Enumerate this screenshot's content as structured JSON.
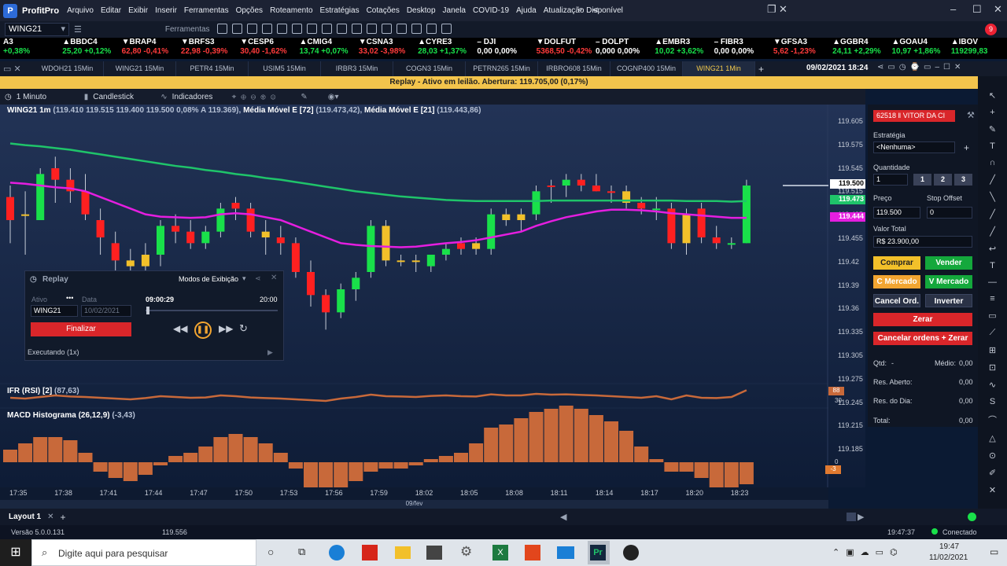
{
  "app": {
    "name": "ProfitPro",
    "menu": [
      "Arquivo",
      "Editar",
      "Exibir",
      "Inserir",
      "Ferramentas",
      "Opções",
      "Roteamento",
      "Estratégias",
      "Cotações",
      "Desktop",
      "Janela",
      "COVID-19",
      "Ajuda",
      "Atualização Disponível"
    ],
    "notify_count": "9"
  },
  "toolbar": {
    "asset": "WING21",
    "tools_label": "Ferramentas"
  },
  "ticker": [
    {
      "name": "A3",
      "value": "+0,38%",
      "dir": "up"
    },
    {
      "name": "▲BBDC4",
      "value": "25,20 +0,12%",
      "dir": "up"
    },
    {
      "name": "▼BRAP4",
      "value": "62,80 -0,41%",
      "dir": "dn"
    },
    {
      "name": "▼BRFS3",
      "value": "22,98 -0,39%",
      "dir": "dn"
    },
    {
      "name": "▼CESP6",
      "value": "30,40 -1,62%",
      "dir": "dn"
    },
    {
      "name": "▲CMIG4",
      "value": "13,74 +0,07%",
      "dir": "up"
    },
    {
      "name": "▼CSNA3",
      "value": "33,02 -3,98%",
      "dir": "dn"
    },
    {
      "name": "▲CYRE3",
      "value": "28,03 +1,37%",
      "dir": "up"
    },
    {
      "name": "– DJI",
      "value": "0,00 0,00%",
      "dir": "fl"
    },
    {
      "name": "▼DOLFUT",
      "value": "5368,50 -0,42%",
      "dir": "dn"
    },
    {
      "name": "– DOLPT",
      "value": "0,000 0,00%",
      "dir": "fl"
    },
    {
      "name": "▲EMBR3",
      "value": "10,02 +3,62%",
      "dir": "up"
    },
    {
      "name": "– FIBR3",
      "value": "0,00 0,00%",
      "dir": "fl"
    },
    {
      "name": "▼GFSA3",
      "value": "5,62 -1,23%",
      "dir": "dn"
    },
    {
      "name": "▲GGBR4",
      "value": "24,11 +2,29%",
      "dir": "up"
    },
    {
      "name": "▲GOAU4",
      "value": "10,97 +1,86%",
      "dir": "up"
    },
    {
      "name": "▲IBOV",
      "value": "119299,83",
      "dir": "up"
    }
  ],
  "tabs": [
    "WDOH21 15Min",
    "WING21 15Min",
    "PETR4 15Min",
    "USIM5 15Min",
    "IRBR3 15Min",
    "COGN3 15Min",
    "PETRN265 15Min",
    "IRBRO608 15Min",
    "COGNP400 15Min",
    "WING21 1Min"
  ],
  "datetime": "09/02/2021 18:24",
  "replay_banner": "Replay - Ativo em leilão. Abertura: 119.705,00 (0,17%)",
  "chart_tools": {
    "interval": "1 Minuto",
    "type": "Candlestick",
    "indicators": "Indicadores"
  },
  "chart_header": {
    "symbol": "WING21 1m",
    "ohlc": "(119.410  119.515  119.400  119.500  0,08%  A 119.369),",
    "ma1_label": "Média Móvel E [72]",
    "ma1_value": "(119.473,42),",
    "ma2_label": "Média Móvel E [21]",
    "ma2_value": "(119.443,86)"
  },
  "price_axis": [
    "119.605",
    "119.575",
    "119.545",
    "119.515",
    "119.485",
    "119.455",
    "119.42",
    "119.39",
    "119.36",
    "119.335",
    "119.305",
    "119.275",
    "119.245",
    "119.215",
    "119.185"
  ],
  "price_tags": {
    "last": "119.500",
    "ma1": "119.473",
    "ma2": "119.444"
  },
  "rsi": {
    "label": "IFR (RSI) [2]",
    "value": "(87,63)",
    "tag": "88",
    "level": "30"
  },
  "macd": {
    "label": "MACD Histograma (26,12,9)",
    "value": "(-3,43)",
    "zero": "0",
    "tag": "-3"
  },
  "time_axis": [
    "17:35",
    "17:38",
    "17:41",
    "17:44",
    "17:47",
    "17:50",
    "17:53",
    "17:56",
    "17:59",
    "18:02",
    "18:05",
    "18:08",
    "18:11",
    "18:14",
    "18:17",
    "18:20",
    "18:23"
  ],
  "date_label": "09/fev",
  "right_panel": {
    "account": "62518 ‖ VITOR DA CI",
    "strategy_label": "Estratégia",
    "strategy_value": "<Nenhuma>",
    "qty_label": "Quantidade",
    "qty_value": "1",
    "qty_presets": [
      "1",
      "2",
      "3"
    ],
    "price_label": "Preço",
    "price_value": "119.500",
    "stop_label": "Stop Offset",
    "stop_value": "0",
    "total_label": "Valor Total",
    "total_value": "R$ 23.900,00",
    "buttons": {
      "buy": "Comprar",
      "sell": "Vender",
      "buy_mkt": "C Mercado",
      "sell_mkt": "V Mercado",
      "cancel": "Cancel Ord.",
      "invert": "Inverter",
      "zero": "Zerar",
      "cancel_zero": "Cancelar ordens + Zerar"
    },
    "info": [
      {
        "k": "Qtd:",
        "v": "-",
        "k2": "Médio:",
        "v2": "0,00"
      },
      {
        "k": "Res. Aberto:",
        "v": "0,00"
      },
      {
        "k": "Res. do Dia:",
        "v": "0,00"
      },
      {
        "k": "Total:",
        "v": "0,00"
      }
    ]
  },
  "replay": {
    "title": "Replay",
    "modes": "Modos de Exibição",
    "asset_label": "Ativo",
    "asset_value": "WING21",
    "date_label": "Data",
    "date_value": "10/02/2021",
    "time_current": "09:00:29",
    "time_end": "20:00",
    "finish": "Finalizar",
    "status": "Executando (1x)"
  },
  "bottom": {
    "layout": "Layout 1"
  },
  "status": {
    "version": "Versão 5.0.0.131",
    "price": "119.556",
    "time": "19:47:37",
    "conn": "Conectado"
  },
  "taskbar": {
    "search": "Digite aqui para pesquisar",
    "time": "19:47",
    "date": "11/02/2021"
  },
  "colors": {
    "up": "#19e04a",
    "down": "#ff2020",
    "doji": "#f2c02a",
    "ma72": "#1fc46a",
    "ma21": "#e51ee0",
    "macd": "#c8693a"
  },
  "chart_data": {
    "type": "candlestick",
    "ylim": [
      119.17,
      119.62
    ],
    "candles": [
      [
        119.48,
        119.5,
        119.4,
        119.44,
        "dn"
      ],
      [
        119.45,
        119.49,
        119.38,
        119.45,
        "doji"
      ],
      [
        119.44,
        119.53,
        119.44,
        119.52,
        "up"
      ],
      [
        119.53,
        119.55,
        119.47,
        119.51,
        "dn"
      ],
      [
        119.51,
        119.53,
        119.47,
        119.49,
        "dn"
      ],
      [
        119.49,
        119.52,
        119.44,
        119.45,
        "dn"
      ],
      [
        119.44,
        119.46,
        119.38,
        119.41,
        "dn"
      ],
      [
        119.4,
        119.42,
        119.34,
        119.37,
        "dn"
      ],
      [
        119.37,
        119.39,
        119.34,
        119.36,
        "doji"
      ],
      [
        119.36,
        119.4,
        119.33,
        119.38,
        "doji"
      ],
      [
        119.38,
        119.44,
        119.36,
        119.43,
        "up"
      ],
      [
        119.43,
        119.45,
        119.4,
        119.42,
        "dn"
      ],
      [
        119.42,
        119.44,
        119.39,
        119.4,
        "dn"
      ],
      [
        119.4,
        119.43,
        119.39,
        119.42,
        "up"
      ],
      [
        119.42,
        119.47,
        119.41,
        119.46,
        "up"
      ],
      [
        119.47,
        119.48,
        119.44,
        119.46,
        "dn"
      ],
      [
        119.46,
        119.47,
        119.41,
        119.42,
        "dn"
      ],
      [
        119.42,
        119.44,
        119.38,
        119.41,
        "doji"
      ],
      [
        119.41,
        119.43,
        119.38,
        119.4,
        "dn"
      ],
      [
        119.4,
        119.41,
        119.34,
        119.35,
        "dn"
      ],
      [
        119.35,
        119.37,
        119.29,
        119.31,
        "dn"
      ],
      [
        119.31,
        119.32,
        119.25,
        119.28,
        "dn"
      ],
      [
        119.28,
        119.33,
        119.27,
        119.32,
        "up"
      ],
      [
        119.32,
        119.35,
        119.3,
        119.34,
        "up"
      ],
      [
        119.35,
        119.44,
        119.34,
        119.43,
        "up"
      ],
      [
        119.43,
        119.44,
        119.36,
        119.37,
        "doji"
      ],
      [
        119.37,
        119.38,
        119.36,
        119.37,
        "doji"
      ],
      [
        119.37,
        119.38,
        119.35,
        119.37,
        "doji"
      ],
      [
        119.36,
        119.38,
        119.35,
        119.38,
        "up"
      ],
      [
        119.38,
        119.4,
        119.37,
        119.39,
        "up"
      ],
      [
        119.39,
        119.41,
        119.38,
        119.4,
        "dn"
      ],
      [
        119.4,
        119.41,
        119.38,
        119.39,
        "doji"
      ],
      [
        119.39,
        119.46,
        119.38,
        119.45,
        "up"
      ],
      [
        119.45,
        119.46,
        119.43,
        119.44,
        "doji"
      ],
      [
        119.44,
        119.46,
        119.42,
        119.45,
        "doji"
      ],
      [
        119.45,
        119.5,
        119.44,
        119.49,
        "up"
      ],
      [
        119.5,
        119.51,
        119.47,
        119.5,
        "dn"
      ],
      [
        119.5,
        119.52,
        119.48,
        119.51,
        "up"
      ],
      [
        119.51,
        119.52,
        119.49,
        119.5,
        "dn"
      ],
      [
        119.5,
        119.52,
        119.49,
        119.49,
        "dn"
      ],
      [
        119.49,
        119.5,
        119.47,
        119.49,
        "dn"
      ],
      [
        119.49,
        119.5,
        119.46,
        119.47,
        "doji"
      ],
      [
        119.47,
        119.48,
        119.45,
        119.46,
        "dn"
      ],
      [
        119.46,
        119.48,
        119.44,
        119.46,
        "up"
      ],
      [
        119.46,
        119.47,
        119.39,
        119.4,
        "dn"
      ],
      [
        119.4,
        119.46,
        119.38,
        119.45,
        "doji"
      ],
      [
        119.46,
        119.47,
        119.4,
        119.41,
        "dn"
      ],
      [
        119.41,
        119.43,
        119.39,
        119.4,
        "dn"
      ],
      [
        119.4,
        119.41,
        119.39,
        119.4,
        "up"
      ],
      [
        119.4,
        119.51,
        119.4,
        119.5,
        "up"
      ]
    ],
    "ma72": [
      119.573,
      119.57,
      119.568,
      119.565,
      119.562,
      119.558,
      119.554,
      119.55,
      119.546,
      119.542,
      119.538,
      119.534,
      119.531,
      119.527,
      119.524,
      119.52,
      119.517,
      119.513,
      119.51,
      119.506,
      119.502,
      119.498,
      119.494,
      119.49,
      119.487,
      119.484,
      119.481,
      119.479,
      119.477,
      119.475,
      119.474,
      119.473,
      119.473,
      119.473,
      119.473,
      119.473,
      119.474,
      119.474,
      119.474,
      119.474,
      119.474,
      119.474,
      119.474,
      119.474,
      119.474,
      119.473,
      119.473,
      119.473,
      119.472,
      119.473
    ],
    "ma21": [
      119.505,
      119.503,
      119.5,
      119.497,
      119.495,
      119.49,
      119.48,
      119.47,
      119.46,
      119.45,
      119.446,
      119.445,
      119.444,
      119.445,
      119.45,
      119.452,
      119.45,
      119.445,
      119.44,
      119.43,
      119.42,
      119.41,
      119.4,
      119.397,
      119.395,
      119.394,
      119.393,
      119.394,
      119.397,
      119.4,
      119.402,
      119.405,
      119.41,
      119.415,
      119.42,
      119.43,
      119.438,
      119.445,
      119.45,
      119.455,
      119.458,
      119.458,
      119.457,
      119.455,
      119.452,
      119.45,
      119.448,
      119.446,
      119.444,
      119.444
    ],
    "rsi": [
      40,
      35,
      45,
      55,
      48,
      45,
      40,
      35,
      30,
      38,
      50,
      45,
      40,
      42,
      55,
      50,
      42,
      38,
      35,
      30,
      25,
      20,
      35,
      45,
      60,
      50,
      48,
      45,
      52,
      55,
      50,
      48,
      62,
      55,
      55,
      65,
      60,
      62,
      58,
      55,
      50,
      45,
      40,
      50,
      30,
      55,
      40,
      38,
      45,
      88
    ],
    "macd": [
      0.4,
      0.6,
      0.8,
      0.8,
      0.7,
      0.3,
      -0.3,
      -0.5,
      -0.6,
      -0.4,
      -0.1,
      0.2,
      0.3,
      0.5,
      0.8,
      0.9,
      0.8,
      0.6,
      0.3,
      -0.2,
      -0.9,
      -1.0,
      -0.9,
      -0.6,
      -0.3,
      -0.2,
      -0.2,
      -0.1,
      0.1,
      0.2,
      0.3,
      0.6,
      1.1,
      1.2,
      1.4,
      1.6,
      1.7,
      1.8,
      1.7,
      1.5,
      1.3,
      1.0,
      0.5,
      0.1,
      -0.3,
      -0.3,
      -0.5,
      -0.8,
      -1.0,
      -0.7
    ]
  }
}
